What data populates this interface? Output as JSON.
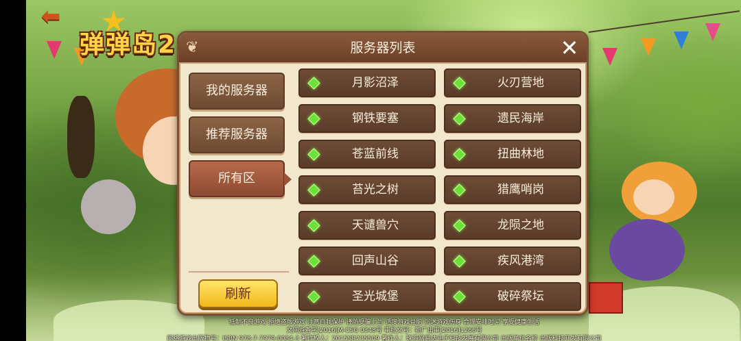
{
  "game": {
    "logo_text": "弹弹岛2"
  },
  "dialog": {
    "title": "服务器列表",
    "close_symbol": "✕"
  },
  "side_tabs": [
    {
      "label": "我的服务器",
      "active": false
    },
    {
      "label": "推荐服务器",
      "active": false
    },
    {
      "label": "所有区",
      "active": true
    }
  ],
  "refresh_label": "刷新",
  "servers": [
    {
      "name": "月影沼泽",
      "status": "online"
    },
    {
      "name": "火刃营地",
      "status": "online"
    },
    {
      "name": "钢铁要塞",
      "status": "online"
    },
    {
      "name": "遗民海岸",
      "status": "online"
    },
    {
      "name": "苍蓝前线",
      "status": "online"
    },
    {
      "name": "扭曲林地",
      "status": "online"
    },
    {
      "name": "苔光之树",
      "status": "online"
    },
    {
      "name": "猎鹰哨岗",
      "status": "online"
    },
    {
      "name": "天谴兽穴",
      "status": "online"
    },
    {
      "name": "龙陨之地",
      "status": "online"
    },
    {
      "name": "回声山谷",
      "status": "online"
    },
    {
      "name": "疾风港湾",
      "status": "online"
    },
    {
      "name": "圣光城堡",
      "status": "online"
    },
    {
      "name": "破碎祭坛",
      "status": "online"
    }
  ],
  "footer": {
    "line1": "抵制不良游戏  拒绝盗版游戏  注意自我保护  谨防受骗上当  适度游戏益脑  沉迷游戏伤身  合理安排时间  享受健康生活",
    "line2": "文网游备字[2016]M-CSG 0348号  审批文号：新广出审[2016]1266号",
    "line3": "网络游戏出版物号：ISBN 978-7-7979-0084-3  著作权人：2015SR235509  著作人：珠海网易达电子科技发展有限公司  出版单位名称  出版科技开发有限公司"
  },
  "colors": {
    "status_online": "#6ee03a",
    "refresh_button": "#f2b81a",
    "dialog_bg": "#f2e6cc"
  }
}
